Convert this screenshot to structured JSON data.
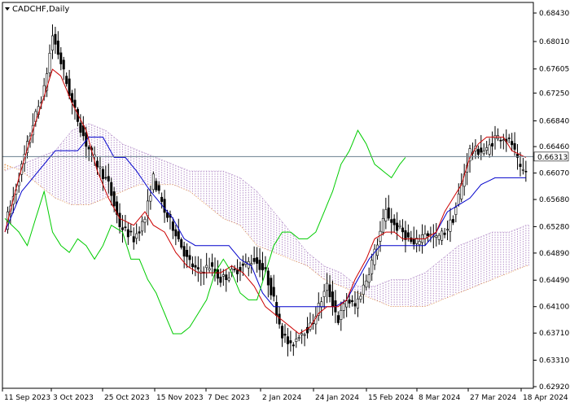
{
  "window": {
    "symbol_title": "CADCHF,Daily",
    "menu_icon": "triangle-down-icon"
  },
  "colors": {
    "background": "#ffffff",
    "frame": "#000000",
    "candle": "#000000",
    "tenkan": "#cc0000",
    "kijun": "#0000cc",
    "chikou": "#00cc00",
    "cloud_bearish": "#e08a3c",
    "cloud_bullish": "#b48ec8",
    "price_line": "#6a7f8f",
    "price_box_bg": "#ffffff"
  },
  "current_price_label": "0.66313",
  "chart_data": {
    "type": "candlestick",
    "indicator": "Ichimoku Kinko Hyo",
    "x_tick_labels": [
      "11 Sep 2023",
      "3 Oct 2023",
      "25 Oct 2023",
      "15 Nov 2023",
      "7 Dec 2023",
      "2 Jan 2024",
      "24 Jan 2024",
      "15 Feb 2024",
      "8 Mar 2024",
      "27 Mar 2024",
      "18 Apr 2024"
    ],
    "y_tick_labels": [
      "0.68430",
      "0.68010",
      "0.67605",
      "0.67250",
      "0.66840",
      "0.66460",
      "0.66070",
      "0.65680",
      "0.65280",
      "0.64890",
      "0.64490",
      "0.64100",
      "0.63710",
      "0.63310",
      "0.62920"
    ],
    "ylim": [
      0.6292,
      0.6843
    ],
    "current_price": 0.66313,
    "grid": false,
    "anchors": {
      "close": [
        [
          0,
          0.653
        ],
        [
          5,
          0.66
        ],
        [
          10,
          0.668
        ],
        [
          14,
          0.673
        ],
        [
          17,
          0.681
        ],
        [
          20,
          0.677
        ],
        [
          24,
          0.671
        ],
        [
          29,
          0.665
        ],
        [
          33,
          0.662
        ],
        [
          37,
          0.659
        ],
        [
          41,
          0.653
        ],
        [
          46,
          0.651
        ],
        [
          50,
          0.654
        ],
        [
          53,
          0.66
        ],
        [
          57,
          0.655
        ],
        [
          61,
          0.652
        ],
        [
          65,
          0.648
        ],
        [
          69,
          0.646
        ],
        [
          73,
          0.647
        ],
        [
          77,
          0.645
        ],
        [
          81,
          0.646
        ],
        [
          85,
          0.647
        ],
        [
          89,
          0.648
        ],
        [
          93,
          0.646
        ],
        [
          96,
          0.642
        ],
        [
          99,
          0.637
        ],
        [
          102,
          0.635
        ],
        [
          105,
          0.637
        ],
        [
          109,
          0.638
        ],
        [
          112,
          0.641
        ],
        [
          115,
          0.644
        ],
        [
          119,
          0.639
        ],
        [
          122,
          0.642
        ],
        [
          125,
          0.641
        ],
        [
          129,
          0.645
        ],
        [
          132,
          0.649
        ],
        [
          136,
          0.655
        ],
        [
          139,
          0.653
        ],
        [
          142,
          0.652
        ],
        [
          146,
          0.65
        ],
        [
          150,
          0.652
        ],
        [
          154,
          0.651
        ],
        [
          157,
          0.652
        ],
        [
          160,
          0.654
        ],
        [
          163,
          0.659
        ],
        [
          166,
          0.664
        ],
        [
          169,
          0.664
        ],
        [
          172,
          0.664
        ],
        [
          175,
          0.666
        ],
        [
          178,
          0.666
        ],
        [
          181,
          0.665
        ],
        [
          184,
          0.661
        ],
        [
          186,
          0.661
        ]
      ],
      "tenkan": [
        [
          0,
          0.652
        ],
        [
          5,
          0.66
        ],
        [
          10,
          0.667
        ],
        [
          14,
          0.672
        ],
        [
          17,
          0.676
        ],
        [
          20,
          0.675
        ],
        [
          24,
          0.671
        ],
        [
          29,
          0.667
        ],
        [
          33,
          0.661
        ],
        [
          37,
          0.657
        ],
        [
          41,
          0.654
        ],
        [
          46,
          0.653
        ],
        [
          50,
          0.655
        ],
        [
          53,
          0.653
        ],
        [
          57,
          0.652
        ],
        [
          61,
          0.649
        ],
        [
          65,
          0.647
        ],
        [
          69,
          0.646
        ],
        [
          73,
          0.646
        ],
        [
          77,
          0.646
        ],
        [
          81,
          0.647
        ],
        [
          85,
          0.646
        ],
        [
          89,
          0.644
        ],
        [
          93,
          0.641
        ],
        [
          96,
          0.64
        ],
        [
          99,
          0.639
        ],
        [
          102,
          0.638
        ],
        [
          105,
          0.637
        ],
        [
          109,
          0.638
        ],
        [
          112,
          0.64
        ],
        [
          115,
          0.641
        ],
        [
          119,
          0.641
        ],
        [
          122,
          0.642
        ],
        [
          125,
          0.645
        ],
        [
          129,
          0.648
        ],
        [
          132,
          0.651
        ],
        [
          136,
          0.652
        ],
        [
          139,
          0.652
        ],
        [
          142,
          0.651
        ],
        [
          146,
          0.651
        ],
        [
          150,
          0.651
        ],
        [
          154,
          0.652
        ],
        [
          157,
          0.655
        ],
        [
          160,
          0.657
        ],
        [
          163,
          0.659
        ],
        [
          166,
          0.663
        ],
        [
          169,
          0.665
        ],
        [
          172,
          0.666
        ],
        [
          175,
          0.666
        ],
        [
          178,
          0.666
        ],
        [
          181,
          0.664
        ],
        [
          186,
          0.663
        ]
      ],
      "kijun": [
        [
          0,
          0.652
        ],
        [
          6,
          0.658
        ],
        [
          12,
          0.661
        ],
        [
          18,
          0.664
        ],
        [
          22,
          0.664
        ],
        [
          26,
          0.664
        ],
        [
          30,
          0.666
        ],
        [
          35,
          0.666
        ],
        [
          39,
          0.663
        ],
        [
          43,
          0.663
        ],
        [
          47,
          0.661
        ],
        [
          52,
          0.658
        ],
        [
          56,
          0.656
        ],
        [
          60,
          0.654
        ],
        [
          64,
          0.651
        ],
        [
          68,
          0.65
        ],
        [
          72,
          0.65
        ],
        [
          76,
          0.65
        ],
        [
          80,
          0.65
        ],
        [
          84,
          0.648
        ],
        [
          88,
          0.647
        ],
        [
          92,
          0.643
        ],
        [
          96,
          0.641
        ],
        [
          100,
          0.641
        ],
        [
          105,
          0.641
        ],
        [
          112,
          0.641
        ],
        [
          118,
          0.641
        ],
        [
          122,
          0.642
        ],
        [
          126,
          0.645
        ],
        [
          130,
          0.648
        ],
        [
          134,
          0.65
        ],
        [
          138,
          0.65
        ],
        [
          142,
          0.65
        ],
        [
          146,
          0.65
        ],
        [
          150,
          0.65
        ],
        [
          154,
          0.652
        ],
        [
          158,
          0.655
        ],
        [
          162,
          0.656
        ],
        [
          166,
          0.657
        ],
        [
          170,
          0.659
        ],
        [
          175,
          0.66
        ],
        [
          180,
          0.66
        ],
        [
          186,
          0.66
        ]
      ],
      "chikou": [
        [
          0,
          0.654
        ],
        [
          5,
          0.652
        ],
        [
          8,
          0.65
        ],
        [
          11,
          0.654
        ],
        [
          14,
          0.658
        ],
        [
          17,
          0.652
        ],
        [
          20,
          0.65
        ],
        [
          23,
          0.649
        ],
        [
          26,
          0.651
        ],
        [
          29,
          0.65
        ],
        [
          32,
          0.648
        ],
        [
          35,
          0.65
        ],
        [
          38,
          0.653
        ],
        [
          42,
          0.652
        ],
        [
          45,
          0.648
        ],
        [
          48,
          0.648
        ],
        [
          51,
          0.645
        ],
        [
          54,
          0.643
        ],
        [
          57,
          0.64
        ],
        [
          60,
          0.637
        ],
        [
          63,
          0.637
        ],
        [
          66,
          0.638
        ],
        [
          69,
          0.64
        ],
        [
          72,
          0.642
        ],
        [
          75,
          0.646
        ],
        [
          78,
          0.648
        ],
        [
          81,
          0.646
        ],
        [
          84,
          0.643
        ],
        [
          87,
          0.642
        ],
        [
          90,
          0.642
        ],
        [
          93,
          0.646
        ],
        [
          96,
          0.65
        ],
        [
          99,
          0.652
        ],
        [
          102,
          0.652
        ],
        [
          105,
          0.651
        ],
        [
          108,
          0.651
        ],
        [
          111,
          0.652
        ],
        [
          114,
          0.655
        ],
        [
          117,
          0.658
        ],
        [
          120,
          0.662
        ],
        [
          123,
          0.664
        ],
        [
          126,
          0.667
        ],
        [
          129,
          0.665
        ],
        [
          132,
          0.662
        ],
        [
          135,
          0.661
        ],
        [
          138,
          0.66
        ],
        [
          141,
          0.662
        ],
        [
          143,
          0.663
        ]
      ],
      "senkouA": [
        [
          0,
          0.661
        ],
        [
          6,
          0.662
        ],
        [
          12,
          0.663
        ],
        [
          18,
          0.664
        ],
        [
          24,
          0.667
        ],
        [
          30,
          0.668
        ],
        [
          36,
          0.667
        ],
        [
          42,
          0.665
        ],
        [
          48,
          0.664
        ],
        [
          54,
          0.663
        ],
        [
          60,
          0.662
        ],
        [
          66,
          0.661
        ],
        [
          72,
          0.661
        ],
        [
          78,
          0.661
        ],
        [
          84,
          0.66
        ],
        [
          90,
          0.658
        ],
        [
          96,
          0.655
        ],
        [
          102,
          0.652
        ],
        [
          108,
          0.649
        ],
        [
          114,
          0.647
        ],
        [
          120,
          0.646
        ],
        [
          126,
          0.644
        ],
        [
          132,
          0.644
        ],
        [
          138,
          0.645
        ],
        [
          144,
          0.645
        ],
        [
          150,
          0.646
        ],
        [
          156,
          0.648
        ],
        [
          162,
          0.65
        ],
        [
          168,
          0.651
        ],
        [
          174,
          0.652
        ],
        [
          180,
          0.652
        ],
        [
          186,
          0.653
        ],
        [
          192,
          0.653
        ],
        [
          198,
          0.653
        ],
        [
          205,
          0.654
        ],
        [
          212,
          0.654
        ]
      ],
      "senkouB": [
        [
          0,
          0.662
        ],
        [
          6,
          0.661
        ],
        [
          12,
          0.659
        ],
        [
          18,
          0.657
        ],
        [
          24,
          0.656
        ],
        [
          30,
          0.656
        ],
        [
          36,
          0.657
        ],
        [
          42,
          0.658
        ],
        [
          48,
          0.659
        ],
        [
          54,
          0.659
        ],
        [
          60,
          0.659
        ],
        [
          66,
          0.658
        ],
        [
          72,
          0.656
        ],
        [
          78,
          0.654
        ],
        [
          84,
          0.653
        ],
        [
          90,
          0.65
        ],
        [
          96,
          0.649
        ],
        [
          102,
          0.648
        ],
        [
          108,
          0.647
        ],
        [
          114,
          0.645
        ],
        [
          120,
          0.644
        ],
        [
          126,
          0.643
        ],
        [
          132,
          0.642
        ],
        [
          138,
          0.641
        ],
        [
          144,
          0.641
        ],
        [
          150,
          0.641
        ],
        [
          156,
          0.642
        ],
        [
          162,
          0.643
        ],
        [
          168,
          0.644
        ],
        [
          174,
          0.645
        ],
        [
          180,
          0.646
        ],
        [
          186,
          0.647
        ],
        [
          192,
          0.647
        ],
        [
          198,
          0.647
        ],
        [
          205,
          0.647
        ],
        [
          212,
          0.647
        ]
      ]
    }
  }
}
